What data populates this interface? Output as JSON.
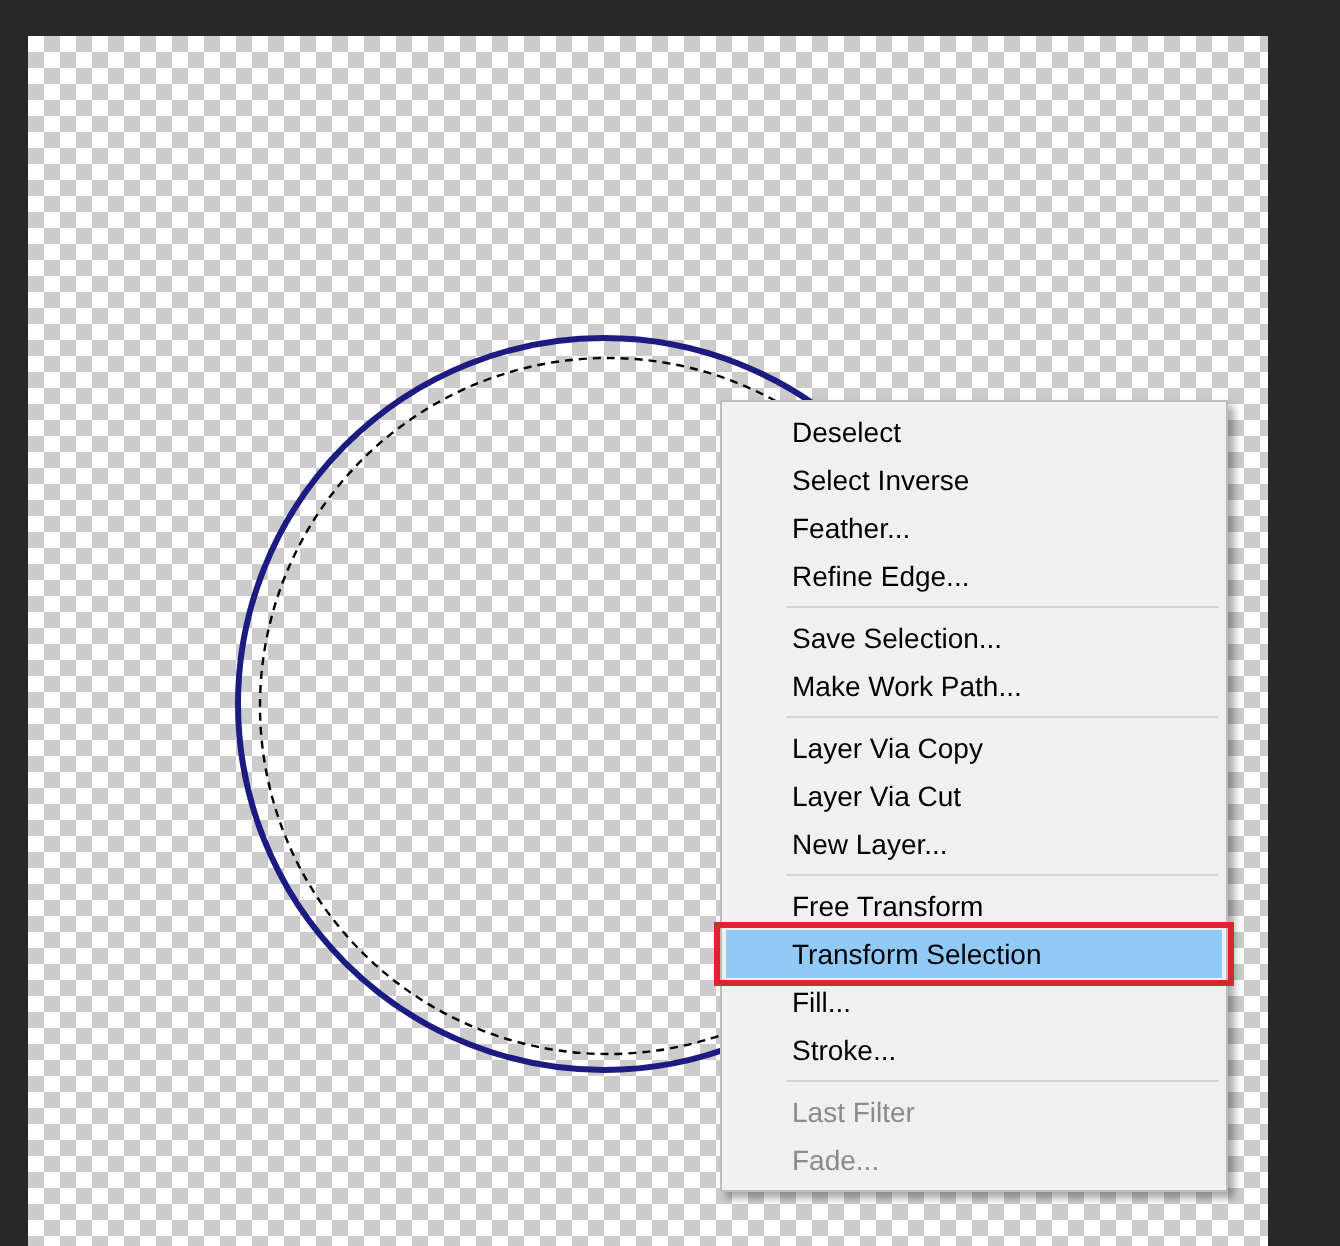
{
  "context_menu": {
    "groups": [
      {
        "items": [
          {
            "label": "Deselect",
            "selected": false,
            "disabled": false,
            "callout": false
          },
          {
            "label": "Select Inverse",
            "selected": false,
            "disabled": false,
            "callout": false
          },
          {
            "label": "Feather...",
            "selected": false,
            "disabled": false,
            "callout": false
          },
          {
            "label": "Refine Edge...",
            "selected": false,
            "disabled": false,
            "callout": false
          }
        ]
      },
      {
        "items": [
          {
            "label": "Save Selection...",
            "selected": false,
            "disabled": false,
            "callout": false
          },
          {
            "label": "Make Work Path...",
            "selected": false,
            "disabled": false,
            "callout": false
          }
        ]
      },
      {
        "items": [
          {
            "label": "Layer Via Copy",
            "selected": false,
            "disabled": false,
            "callout": false
          },
          {
            "label": "Layer Via Cut",
            "selected": false,
            "disabled": false,
            "callout": false
          },
          {
            "label": "New Layer...",
            "selected": false,
            "disabled": false,
            "callout": false
          }
        ]
      },
      {
        "items": [
          {
            "label": "Free Transform",
            "selected": false,
            "disabled": false,
            "callout": false
          },
          {
            "label": "Transform Selection",
            "selected": true,
            "disabled": false,
            "callout": true
          },
          {
            "label": "Fill...",
            "selected": false,
            "disabled": false,
            "callout": false
          },
          {
            "label": "Stroke...",
            "selected": false,
            "disabled": false,
            "callout": false
          }
        ]
      },
      {
        "items": [
          {
            "label": "Last Filter",
            "selected": false,
            "disabled": true,
            "callout": false
          },
          {
            "label": "Fade...",
            "selected": false,
            "disabled": true,
            "callout": false
          }
        ]
      }
    ]
  }
}
